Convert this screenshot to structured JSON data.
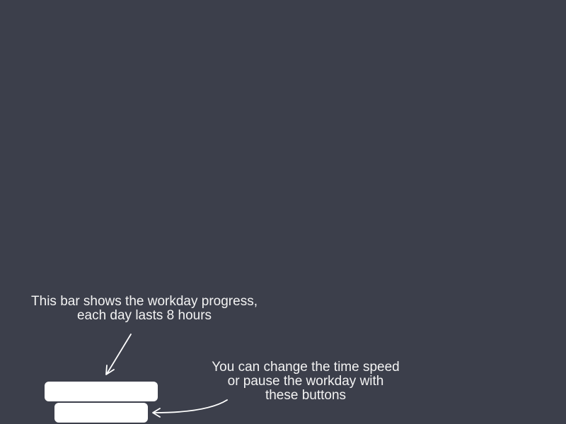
{
  "tutorial": {
    "progress_hint": "This bar shows the workday progress,\neach day lasts 8 hours",
    "speed_hint": "You can change the time speed\nor pause the workday with\nthese buttons"
  },
  "colors": {
    "background": "#3c3f4b",
    "text": "#f3f3f3",
    "panel": "#ffffff"
  },
  "icons": [
    "arrow-down-left-icon",
    "curved-arrow-left-icon"
  ]
}
